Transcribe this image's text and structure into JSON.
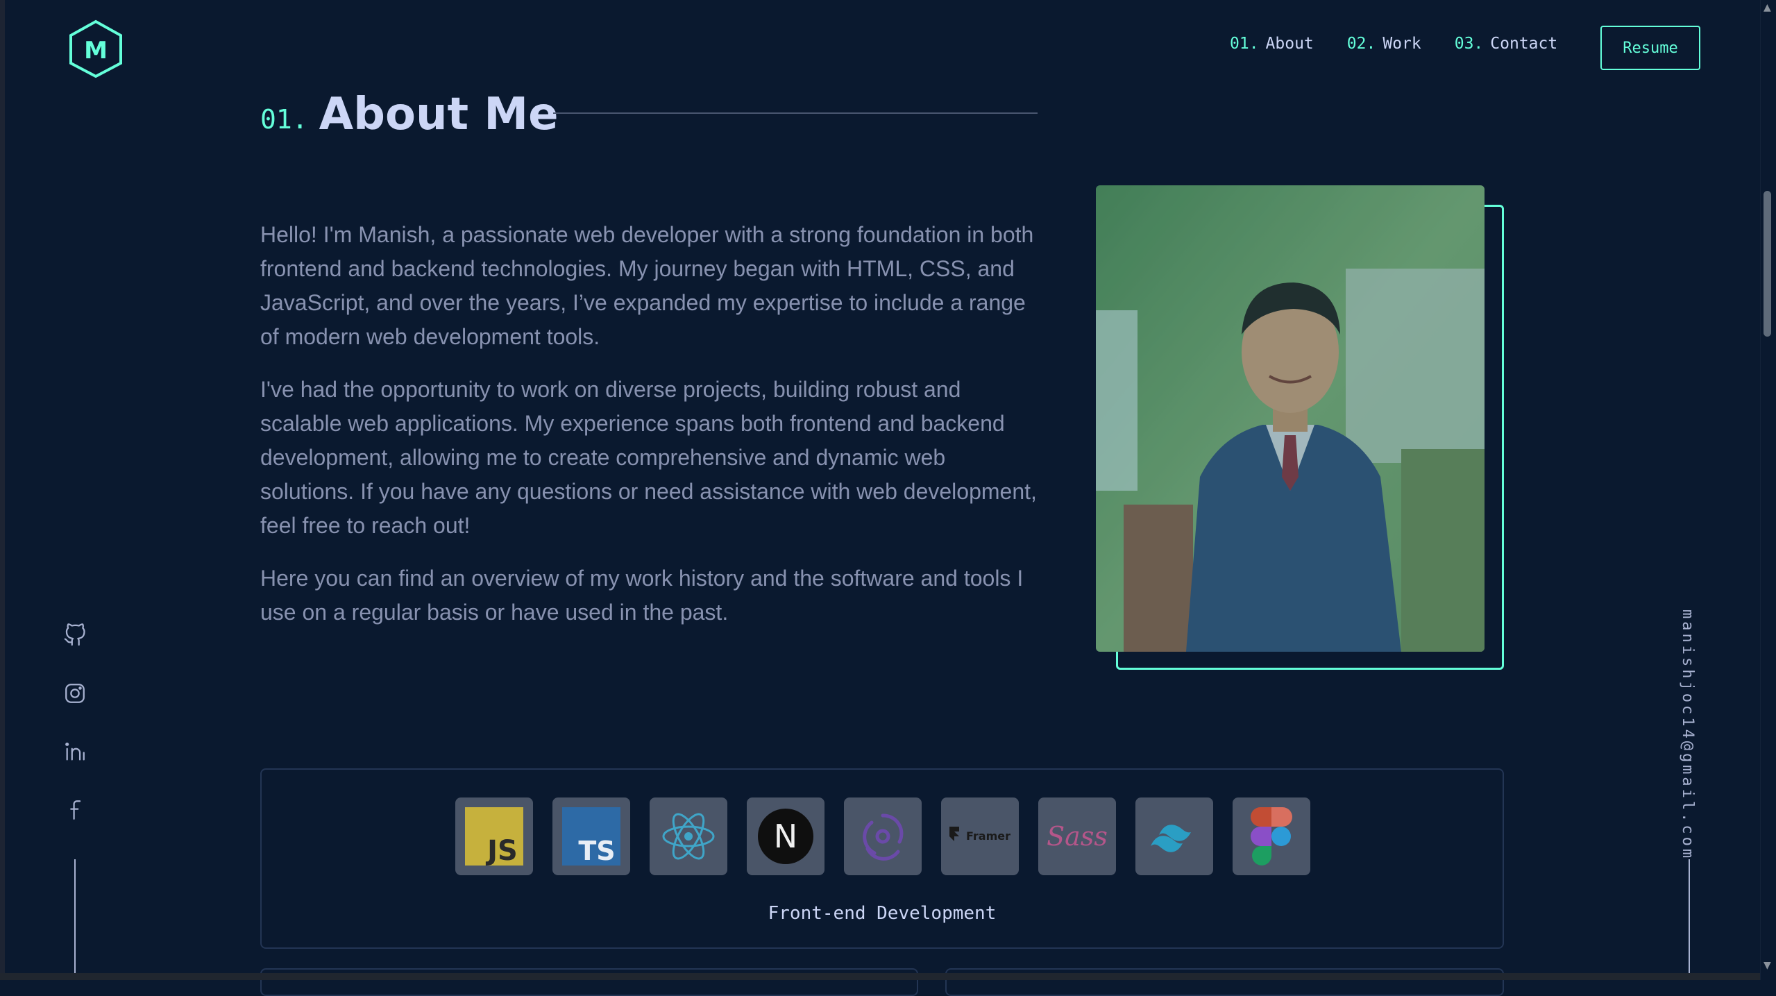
{
  "header": {
    "logo_letter": "M",
    "nav": [
      {
        "num": "01.",
        "label": "About"
      },
      {
        "num": "02.",
        "label": "Work"
      },
      {
        "num": "03.",
        "label": "Contact"
      }
    ],
    "resume_label": "Resume"
  },
  "about": {
    "section_num": "01.",
    "title": "About Me",
    "paragraphs": [
      "Hello! I'm Manish, a passionate web developer with a strong foundation in both frontend and backend technologies. My journey began with HTML, CSS, and JavaScript, and over the years, I’ve expanded my expertise to include a range of modern web development tools.",
      "I've had the opportunity to work on diverse projects, building robust and scalable web applications. My experience spans both frontend and backend development, allowing me to create comprehensive and dynamic web solutions. If you have any questions or need assistance with web development, feel free to reach out!",
      "Here you can find an overview of my work history and the software and tools I use on a regular basis or have used in the past."
    ]
  },
  "social": [
    "github-icon",
    "instagram-icon",
    "linkedin-icon",
    "facebook-icon"
  ],
  "email": "manishjoc14@gmail.com",
  "skills": {
    "frontend": {
      "label": "Front-end Development",
      "tiles": [
        {
          "icon": "javascript-icon",
          "text": "JS"
        },
        {
          "icon": "typescript-icon",
          "text": "TS"
        },
        {
          "icon": "react-icon"
        },
        {
          "icon": "nextjs-icon",
          "text": "N"
        },
        {
          "icon": "redux-icon"
        },
        {
          "icon": "framer-icon",
          "text": "Framer"
        },
        {
          "icon": "sass-icon",
          "text": "Sass"
        },
        {
          "icon": "tailwind-icon"
        },
        {
          "icon": "figma-icon"
        }
      ]
    }
  },
  "colors": {
    "background": "#0a192f",
    "accent": "#64ffda",
    "heading": "#ccd6f6",
    "body_text": "#8892b0"
  }
}
